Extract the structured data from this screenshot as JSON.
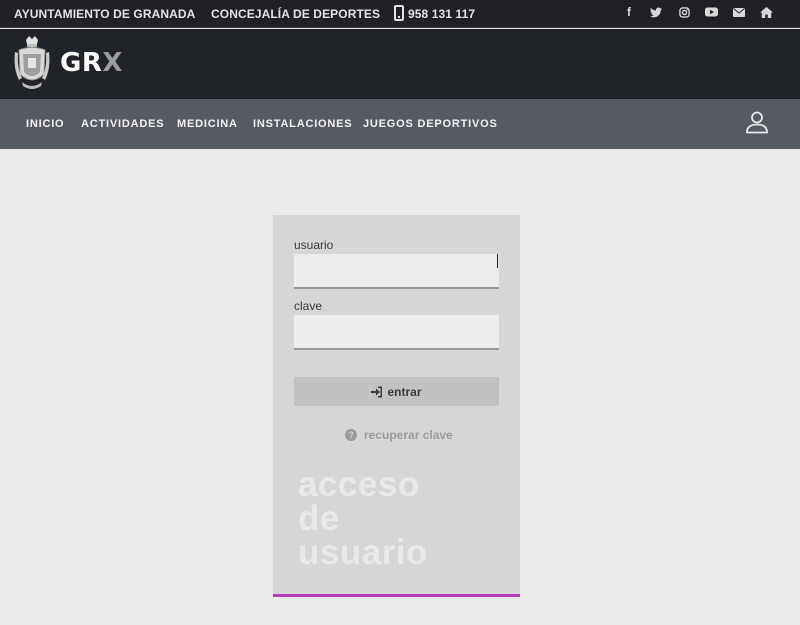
{
  "topbar": {
    "ayuntamiento": "AYUNTAMIENTO DE GRANADA",
    "concejalia": "CONCEJALÍA DE DEPORTES",
    "phone": "958 131 117",
    "social_icons": [
      "facebook-icon",
      "twitter-icon",
      "instagram-icon",
      "youtube-icon",
      "mail-icon",
      "home-icon"
    ]
  },
  "logo": {
    "main": "GR",
    "accent": "X"
  },
  "nav": {
    "items": [
      "INICIO",
      "ACTIVIDADES",
      "MEDICINA",
      "INSTALACIONES",
      "JUEGOS DEPORTIVOS"
    ],
    "user_icon": "user-icon"
  },
  "login": {
    "user_label": "usuario",
    "user_value": "",
    "pass_label": "clave",
    "pass_value": "",
    "submit_label": "entrar",
    "recover_label": "recuperar clave",
    "watermark": [
      "acceso",
      "de",
      "usuario"
    ]
  },
  "colors": {
    "topbar_bg": "#1f2126",
    "nav_bg": "#565b63",
    "page_bg": "#e9e9e9",
    "card_bg": "#d6d6d6",
    "accent": "#b23bb6"
  }
}
